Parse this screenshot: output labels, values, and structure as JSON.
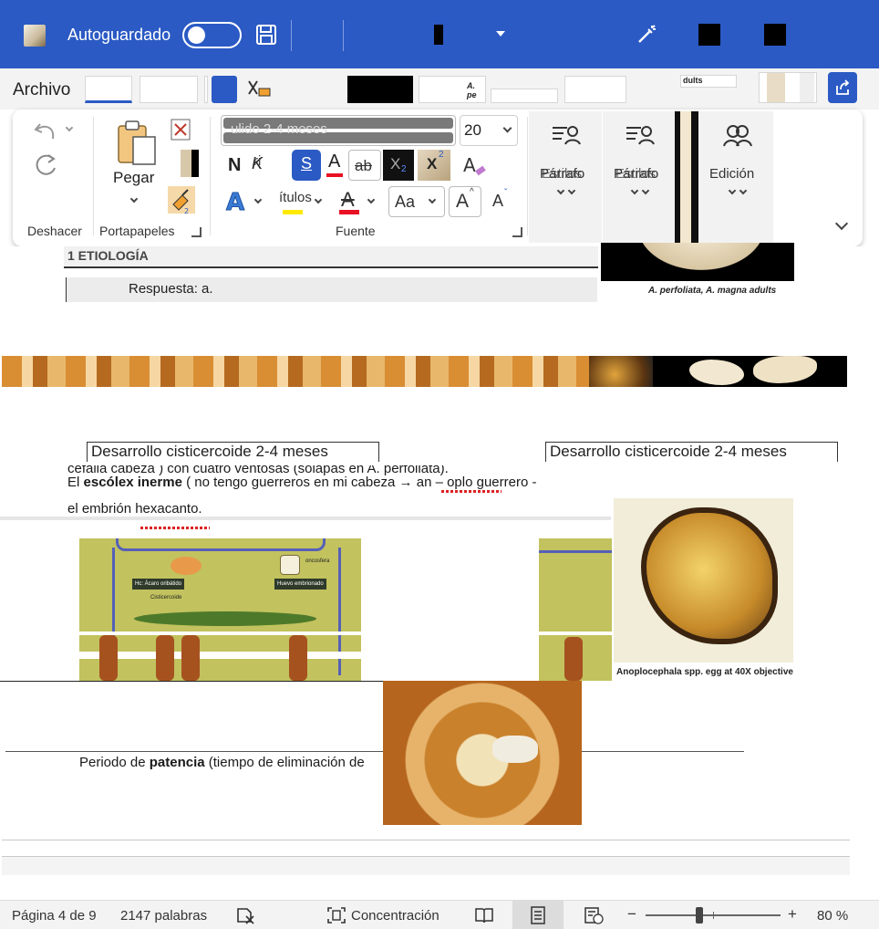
{
  "titlebar": {
    "autosave_label": "Autoguardado"
  },
  "tabs": {
    "archivo": "Archivo"
  },
  "ribbon": {
    "undo_group": "Deshacer",
    "clipboard_group": "Portapapeles",
    "paste_label": "Pegar",
    "font_group": "Fuente",
    "font_size": "20",
    "bold": "N",
    "italic": "K",
    "underline": "S",
    "strike": "ab",
    "subscript": "X",
    "superscript": "X",
    "text_effects": "A",
    "case": "Aa",
    "grow": "A",
    "shrink": "A",
    "styles_1": "Párrafo",
    "styles_2": "Párrafo",
    "editing": "Edición",
    "styles_1_overlap": "Estilos",
    "styles_2_overlap": "Estilos",
    "editing_overlap": "Edición"
  },
  "document": {
    "heading": "1  ETIOLOGÍA",
    "answer": "Respuesta: a.",
    "photo1_caption": "A. perfoliata, A. magna adults",
    "photo2_caption": "Anoplocephala spp. egg at 40X objective",
    "boxed_title_left": "Desarrollo cisticercoide  2-4 meses",
    "boxed_title_right": "Desarrollo cisticercoide  2-4 meses",
    "line_cut": "cefalia  cabeza ) con cuatro ventosas (solapas en A. perfoliata).",
    "line_escolex_pre": "El ",
    "line_escolex_bold": "escólex inerme",
    "line_escolex_post": " (  no tengo guerreros en mi cabeza   → an – oplo   guerrero  -",
    "line_embrion": "el embrión hexacanto.",
    "line_patencia_pre": "Periodo de ",
    "line_patencia_bold": "patencia",
    "line_patencia_post": " (tiempo de eliminación de",
    "cycle_label_1": "Hc: Ácaro oribátido",
    "cycle_label_2": "Huevo embrionado",
    "cycle_label_3": "Cisticercoide",
    "cycle_label_4": "oncosfera",
    "toolbar_text_fragment": "ulido  2-4 meses",
    "small_fragment": "dults"
  },
  "statusbar": {
    "page": "Página 4 de 9",
    "words": "2147 palabras",
    "focus": "Concentración",
    "zoom": "80 %",
    "minus": "−",
    "plus": "+"
  }
}
